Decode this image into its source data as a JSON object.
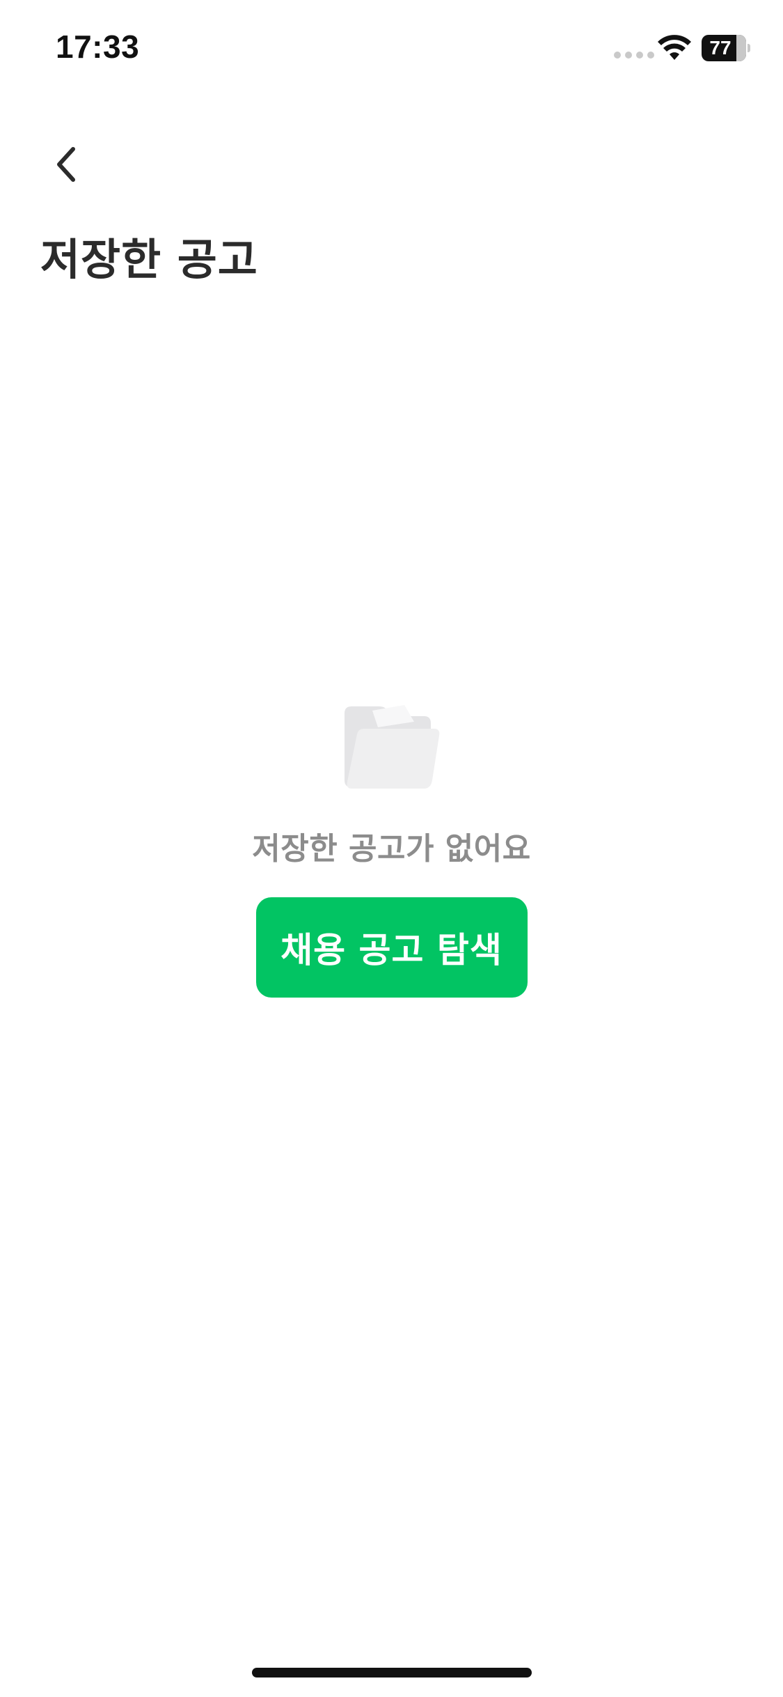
{
  "status_bar": {
    "time": "17:33",
    "battery_level": "77",
    "icons": [
      "cellular-signal-icon",
      "wifi-icon",
      "battery-icon"
    ]
  },
  "header": {
    "back_icon": "chevron-left-icon",
    "title": "저장한 공고"
  },
  "empty_state": {
    "icon": "folder-icon",
    "message": "저장한 공고가 없어요",
    "button_label": "채용 공고 탐색"
  },
  "colors": {
    "accent": "#02c463",
    "title_text": "#2b2b2b",
    "muted_text": "#8c8c8c",
    "icon_gray": "#e6e6e8"
  }
}
